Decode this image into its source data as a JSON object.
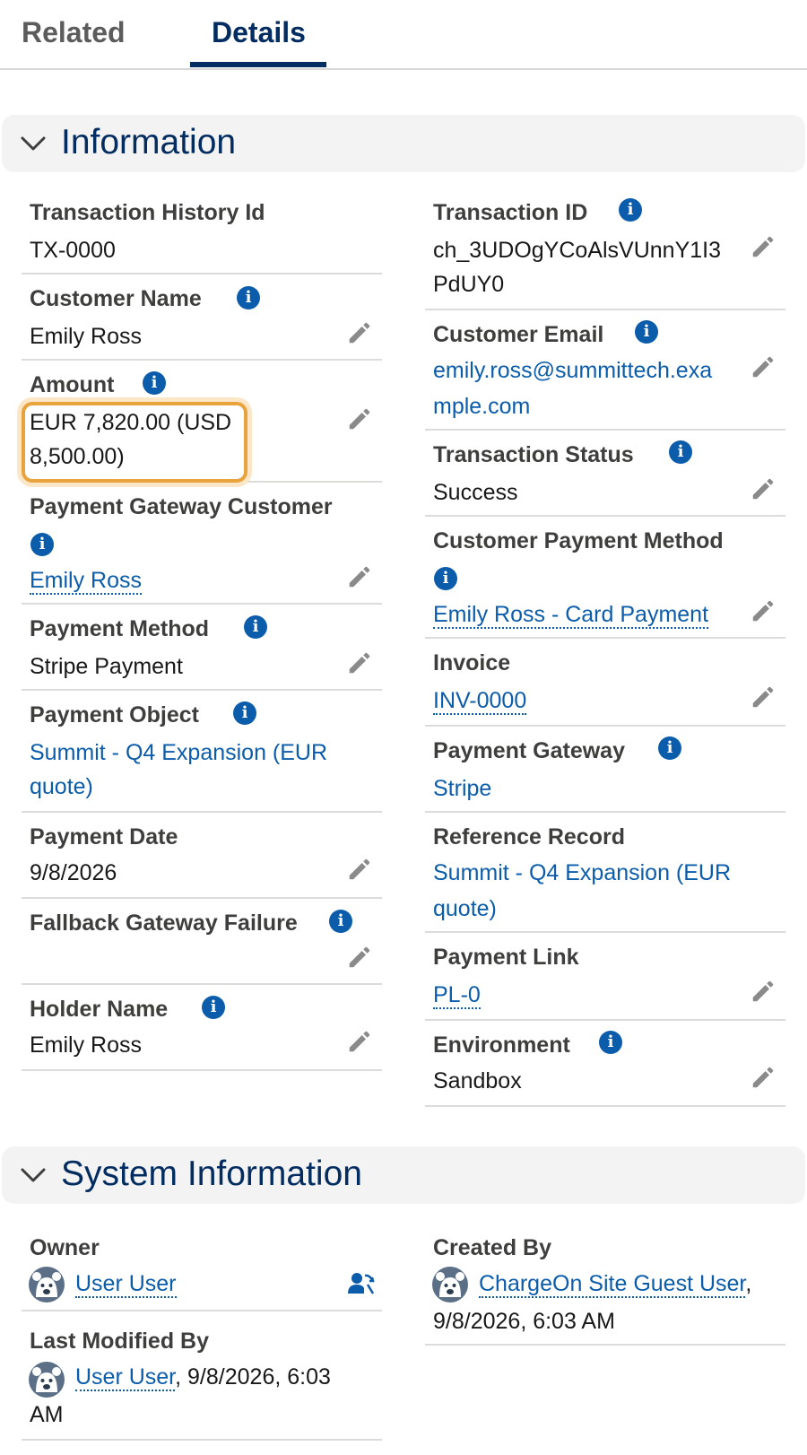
{
  "tabs": {
    "related": "Related",
    "details": "Details"
  },
  "sections": {
    "information": "Information",
    "system_information": "System Information"
  },
  "left": {
    "transaction_history_id": {
      "label": "Transaction History Id",
      "value": "TX-0000"
    },
    "customer_name": {
      "label": "Customer Name",
      "value": "Emily Ross"
    },
    "amount": {
      "label": "Amount",
      "value_line1": "EUR 7,820.00 (USD",
      "value_line2": "8,500.00)"
    },
    "payment_gateway_customer": {
      "label": "Payment Gateway Customer",
      "value": "Emily Ross"
    },
    "payment_method": {
      "label": "Payment Method",
      "value": "Stripe Payment"
    },
    "payment_object": {
      "label": "Payment Object",
      "value_line1": "Summit - Q4 Expansion (EUR",
      "value_line2": "quote)"
    },
    "payment_date": {
      "label": "Payment Date",
      "value": "9/8/2026"
    },
    "fallback_gateway_failure": {
      "label": "Fallback Gateway Failure",
      "value": ""
    },
    "holder_name": {
      "label": "Holder Name",
      "value": "Emily Ross"
    }
  },
  "right": {
    "transaction_id": {
      "label": "Transaction ID",
      "value_line1": "ch_3UDOgYCoAlsVUnnY1I3",
      "value_line2": "PdUY0"
    },
    "customer_email": {
      "label": "Customer Email",
      "value_line1": "emily.ross@summittech.exa",
      "value_line2": "mple.com"
    },
    "transaction_status": {
      "label": "Transaction Status",
      "value": "Success"
    },
    "customer_payment_method": {
      "label": "Customer Payment Method",
      "value": "Emily Ross - Card Payment"
    },
    "invoice": {
      "label": "Invoice",
      "value": "INV-0000"
    },
    "payment_gateway": {
      "label": "Payment Gateway",
      "value": "Stripe"
    },
    "reference_record": {
      "label": "Reference Record",
      "value_line1": "Summit - Q4 Expansion (EUR",
      "value_line2": "quote)"
    },
    "payment_link": {
      "label": "Payment Link",
      "value": "PL-0"
    },
    "environment": {
      "label": "Environment",
      "value": "Sandbox"
    }
  },
  "system": {
    "owner": {
      "label": "Owner",
      "value": "User User"
    },
    "created_by": {
      "label": "Created By",
      "user": "ChargeOn Site Guest User",
      "suffix": ",",
      "date": "9/8/2026, 6:03 AM"
    },
    "last_modified_by": {
      "label": "Last Modified By",
      "user": "User User",
      "suffix": ", 9/8/2026, 6:03",
      "line2": "AM"
    }
  },
  "icons": {
    "info": "info-icon",
    "edit": "pencil-icon",
    "avatar": "user-avatar-icon",
    "change_owner": "change-owner-icon",
    "collapse": "chevron-down-icon"
  },
  "colors": {
    "brand_navy": "#032d60",
    "link": "#0b5cab",
    "highlight": "#e8a33d"
  }
}
